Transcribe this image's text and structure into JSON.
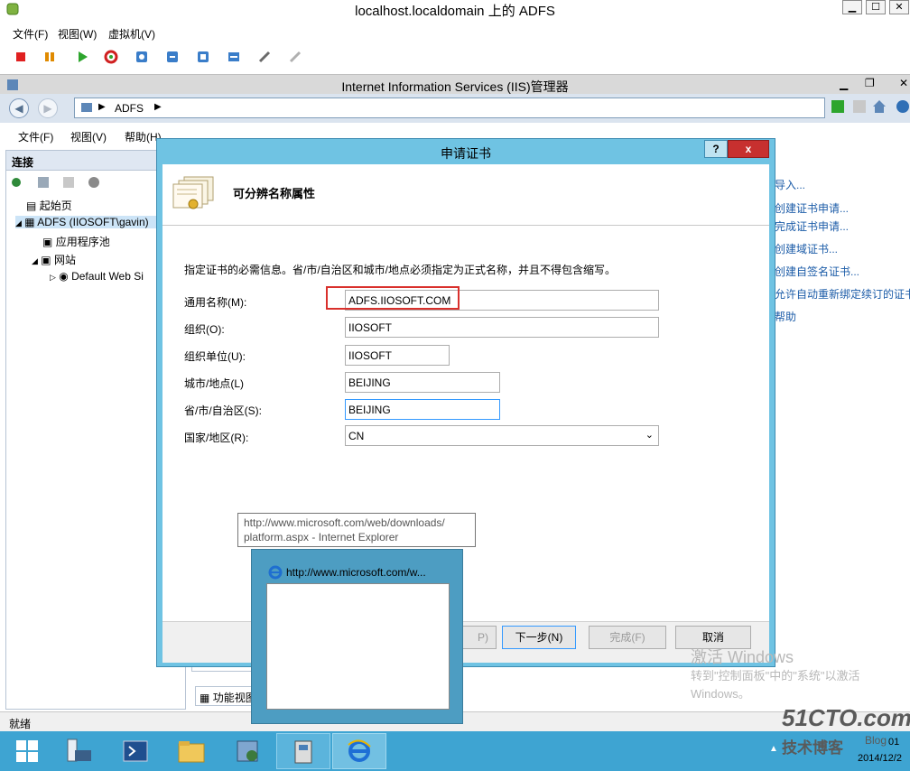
{
  "vm": {
    "title": "localhost.localdomain 上的 ADFS",
    "menu": [
      "文件(F)",
      "视图(W)",
      "虚拟机(V)"
    ]
  },
  "iis": {
    "title": "Internet Information Services (IIS)管理器",
    "address": "ADFS",
    "menu": [
      "文件(F)",
      "视图(V)",
      "帮助(H)"
    ],
    "connections_header": "连接",
    "tree": {
      "start_page": "起始页",
      "server": "ADFS (IIOSOFT\\gavin)",
      "app_pools": "应用程序池",
      "sites": "网站",
      "default_site": "Default Web Si"
    },
    "actions": [
      "导入...",
      "创建证书申请...",
      "完成证书申请...",
      "创建域证书...",
      "创建自签名证书...",
      "允许自动重新绑定续订的证书",
      "帮助"
    ],
    "feature_view_tab": "功能视图",
    "status": "就绪"
  },
  "dialog": {
    "title": "申请证书",
    "help_label": "?",
    "close_label": "x",
    "heading": "可分辨名称属性",
    "instruction": "指定证书的必需信息。省/市/自治区和城市/地点必须指定为正式名称，并且不得包含缩写。",
    "fields": [
      {
        "label": "通用名称(M):",
        "value": "ADFS.IIOSOFT.COM"
      },
      {
        "label": "组织(O):",
        "value": "IIOSOFT"
      },
      {
        "label": "组织单位(U):",
        "value": "IIOSOFT"
      },
      {
        "label": "城市/地点(L)",
        "value": "BEIJING"
      },
      {
        "label": "省/市/自治区(S):",
        "value": "BEIJING"
      },
      {
        "label": "国家/地区(R):",
        "value": "CN"
      }
    ],
    "buttons": {
      "prev": "P)",
      "next": "下一步(N)",
      "finish": "完成(F)",
      "cancel": "取消"
    }
  },
  "tooltip": {
    "line1": "http://www.microsoft.com/web/downloads/",
    "line2": "platform.aspx - Internet Explorer"
  },
  "thumbnail": {
    "title": "http://www.microsoft.com/w..."
  },
  "watermark": {
    "line1": "激活 Windows",
    "line2": "转到\"控制面板\"中的\"系统\"以激活",
    "line3": "Windows。"
  },
  "tray": {
    "time": "01",
    "date": "2014/12/2",
    "blog_logo": "51CTO.com",
    "blog_sub": "技术博客",
    "blog_word": "Blog"
  }
}
